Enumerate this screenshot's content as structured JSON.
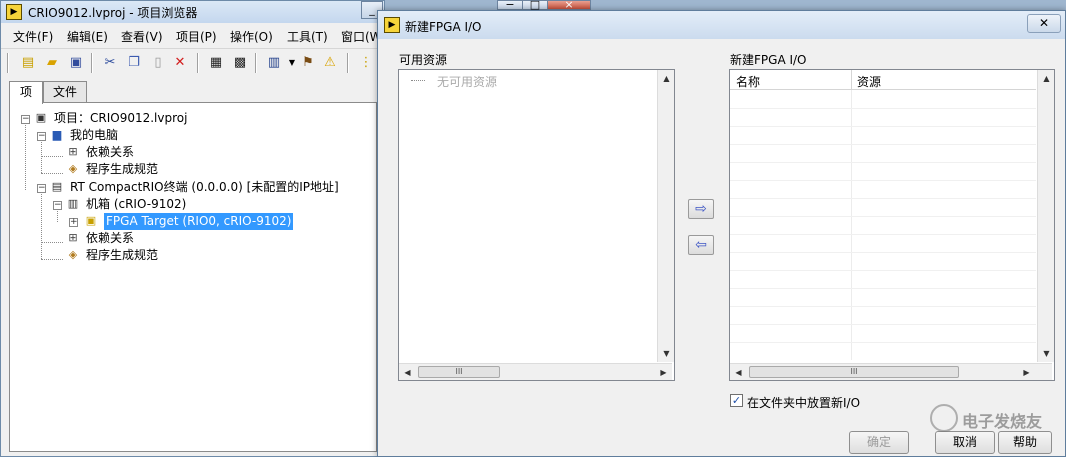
{
  "project_window": {
    "title": "CRIO9012.lvproj - 项目浏览器",
    "menu": [
      "文件(F)",
      "编辑(E)",
      "查看(V)",
      "项目(P)",
      "操作(O)",
      "工具(T)",
      "窗口(W"
    ],
    "tabs": [
      "项",
      "文件"
    ],
    "tree": {
      "root": "项目：CRIO9012.lvproj",
      "my_computer": "我的电脑",
      "deps1": "依赖关系",
      "build1": "程序生成规范",
      "rt_target": "RT CompactRIO终端 (0.0.0.0) [未配置的IP地址]",
      "chassis": "机箱 (cRIO-9102)",
      "fpga": "FPGA Target (RIO0, cRIO-9102)",
      "deps2": "依赖关系",
      "build2": "程序生成规范"
    }
  },
  "dialog": {
    "title": "新建FPGA I/O",
    "available_label": "可用资源",
    "available_empty": "无可用资源",
    "new_io_label": "新建FPGA I/O",
    "columns": [
      "名称",
      "资源"
    ],
    "checkbox_label": "在文件夹中放置新I/O",
    "checkbox_checked": true,
    "ok": "确定",
    "cancel": "取消",
    "help": "帮助",
    "scroll_grip": "III"
  },
  "watermark": "电子发烧友"
}
